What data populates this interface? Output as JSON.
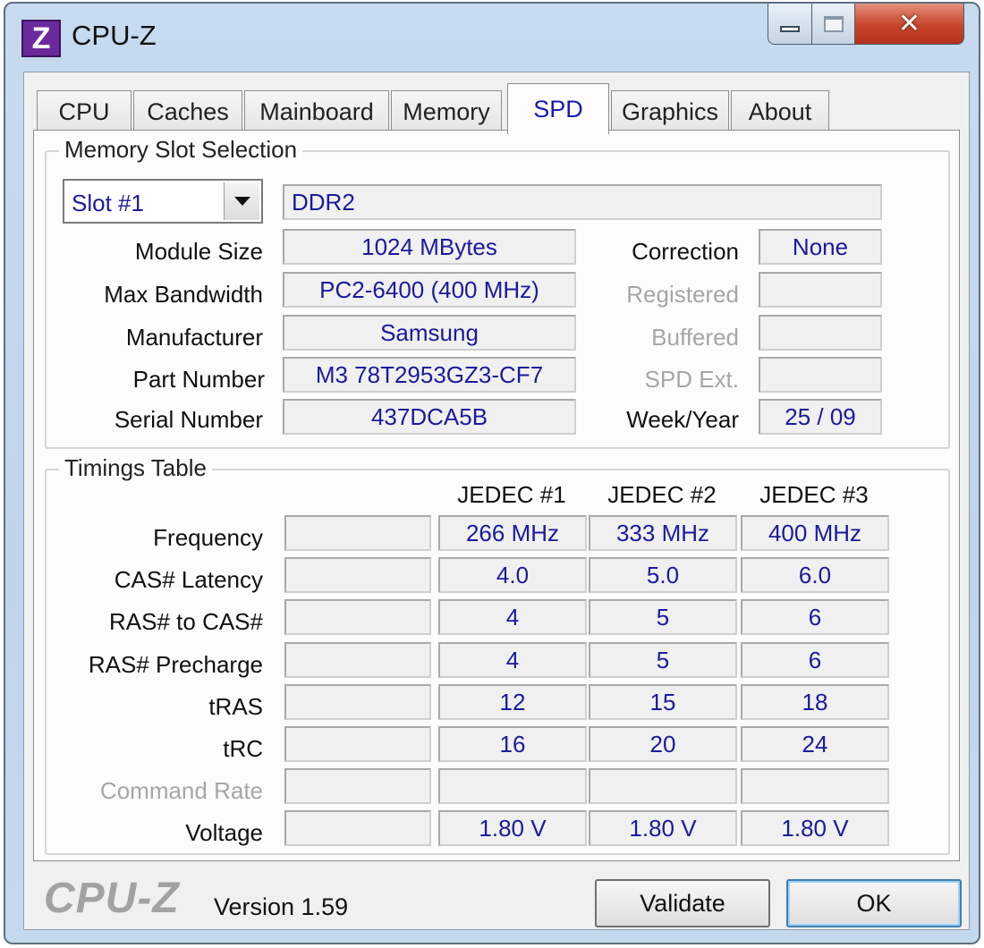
{
  "window": {
    "title": "CPU-Z",
    "icon_letter": "Z",
    "close_glyph": "✕"
  },
  "tabs": [
    "CPU",
    "Caches",
    "Mainboard",
    "Memory",
    "SPD",
    "Graphics",
    "About"
  ],
  "active_tab": "SPD",
  "slot_selection": {
    "title": "Memory Slot Selection",
    "slot_value": "Slot #1",
    "memory_type": "DDR2",
    "module_size_label": "Module Size",
    "module_size": "1024 MBytes",
    "max_bandwidth_label": "Max Bandwidth",
    "max_bandwidth": "PC2-6400 (400 MHz)",
    "manufacturer_label": "Manufacturer",
    "manufacturer": "Samsung",
    "part_number_label": "Part Number",
    "part_number": "M3 78T2953GZ3-CF7",
    "serial_number_label": "Serial Number",
    "serial_number": "437DCA5B",
    "correction_label": "Correction",
    "correction": "None",
    "registered_label": "Registered",
    "registered": "",
    "buffered_label": "Buffered",
    "buffered": "",
    "spd_ext_label": "SPD Ext.",
    "spd_ext": "",
    "week_year_label": "Week/Year",
    "week_year": "25 / 09"
  },
  "timings": {
    "title": "Timings Table",
    "headers": [
      "JEDEC #1",
      "JEDEC #2",
      "JEDEC #3"
    ],
    "rows": [
      {
        "label": "Frequency",
        "values": [
          "266 MHz",
          "333 MHz",
          "400 MHz"
        ]
      },
      {
        "label": "CAS# Latency",
        "values": [
          "4.0",
          "5.0",
          "6.0"
        ]
      },
      {
        "label": "RAS# to CAS#",
        "values": [
          "4",
          "5",
          "6"
        ]
      },
      {
        "label": "RAS# Precharge",
        "values": [
          "4",
          "5",
          "6"
        ]
      },
      {
        "label": "tRAS",
        "values": [
          "12",
          "15",
          "18"
        ]
      },
      {
        "label": "tRC",
        "values": [
          "16",
          "20",
          "24"
        ]
      },
      {
        "label": "Command Rate",
        "values": [
          "",
          "",
          ""
        ]
      },
      {
        "label": "Voltage",
        "values": [
          "1.80 V",
          "1.80 V",
          "1.80 V"
        ]
      }
    ]
  },
  "footer": {
    "logo": "CPU-Z",
    "version": "Version 1.59",
    "validate_label": "Validate",
    "ok_label": "OK"
  },
  "colors": {
    "value_text": "#1a1a9e",
    "dim_label": "#a6a6a6",
    "icon_bg": "#6a2a9c"
  }
}
